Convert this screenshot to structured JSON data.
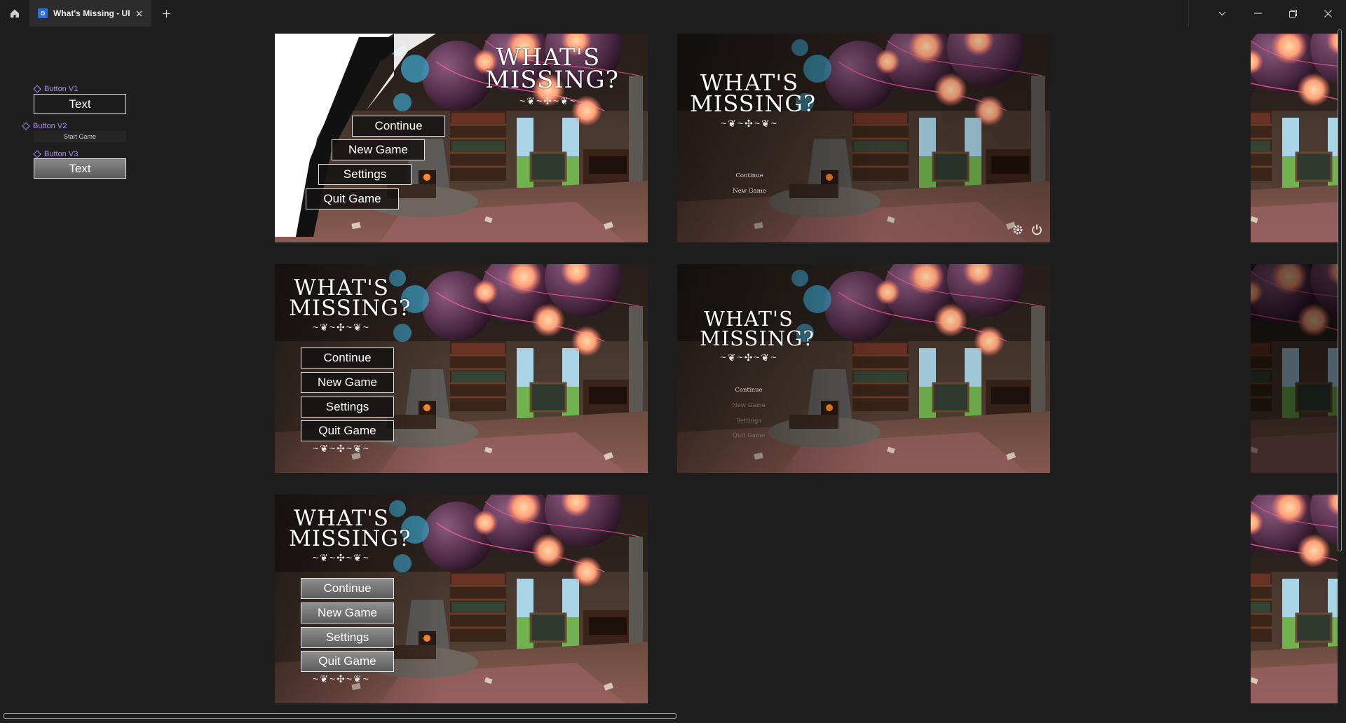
{
  "window": {
    "tab_title": "What's Missing - UI",
    "new_tab_symbol": "+",
    "icons": [
      "home-icon",
      "figma-file-icon",
      "close-icon",
      "plus-icon",
      "chevron-down-icon",
      "minimize-icon",
      "restore-icon",
      "close-window-icon"
    ]
  },
  "components": {
    "v1": {
      "label": "Button V1",
      "text": "Text"
    },
    "v2": {
      "label": "Button V2",
      "text": "Start Game"
    },
    "v3": {
      "label": "Button V3",
      "text": "Text"
    }
  },
  "logo": {
    "line1": "WHAT'S",
    "line2": "MISSING?"
  },
  "menu": {
    "continue": "Continue",
    "new_game": "New Game",
    "settings": "Settings",
    "quit": "Quit Game"
  },
  "colors": {
    "canvas": "#1e1e1e",
    "component_label": "#b28cf2",
    "button_border": "#e6e6e6",
    "button_fill_v3": "#7a7a7a"
  },
  "frame4_icons": [
    "gear-icon",
    "power-icon"
  ]
}
